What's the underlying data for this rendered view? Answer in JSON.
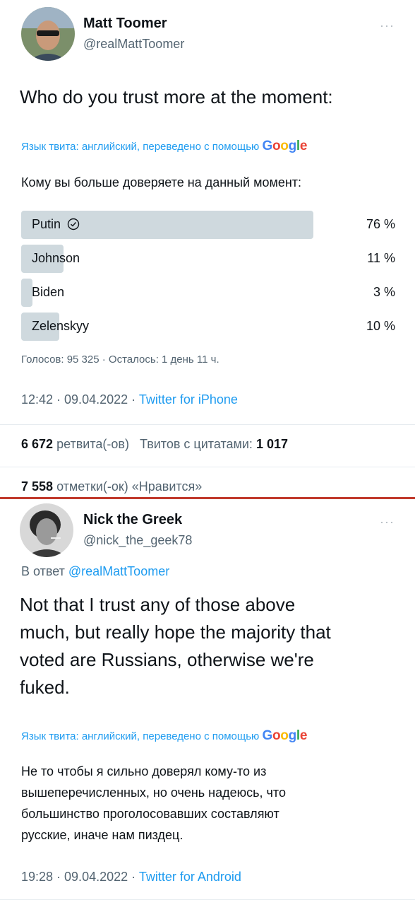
{
  "tweet1": {
    "name": "Matt Toomer",
    "handle": "@realMattToomer",
    "text": "Who do you trust more at the moment:",
    "translate_note": "Язык твита: английский, переведено с помощью",
    "translated": "Кому вы больше доверяете на данный момент:",
    "poll": [
      {
        "label": "Putin",
        "pct": "76 %",
        "fraction": 0.76,
        "winner": true
      },
      {
        "label": "Johnson",
        "pct": "11 %",
        "fraction": 0.11,
        "winner": false
      },
      {
        "label": "Biden",
        "pct": "3 %",
        "fraction": 0.03,
        "winner": false
      },
      {
        "label": "Zelenskyy",
        "pct": "10 %",
        "fraction": 0.1,
        "winner": false
      }
    ],
    "votes": "Голосов: 95 325 · Осталось: 1 день 11 ч.",
    "time": "12:42 · 09.04.2022 · ",
    "source": "Twitter for iPhone",
    "retweets_count": "6 672",
    "retweets_label": "ретвита(-ов)",
    "quotes_label": "Твитов с цитатами:",
    "quotes_count": "1 017",
    "likes_count": "7 558",
    "likes_label": "отметки(-ок) «Нравится»"
  },
  "tweet2": {
    "name": "Nick the Greek",
    "handle": "@nick_the_geek78",
    "reply_prefix": "В ответ ",
    "reply_to": "@realMattToomer",
    "text_lines": [
      "Not that I trust any of those above",
      "much, but really hope the majority that",
      "voted are Russians, otherwise we're",
      "fuked."
    ],
    "translate_note": "Язык твита: английский, переведено с помощью",
    "translated_lines": [
      "Не то чтобы я сильно доверял кому-то из",
      "вышеперечисленных, но очень надеюсь, что",
      "большинство проголосовавших составляют",
      "русские, иначе нам пиздец."
    ],
    "time": "19:28 · 09.04.2022 · ",
    "source": "Twitter for Android"
  },
  "google_letters": [
    "G",
    "o",
    "o",
    "g",
    "l",
    "e"
  ],
  "colors": {
    "link": "#1d9bf0",
    "poll_bar": "#cfd9de",
    "divider_red": "#c0392b"
  },
  "icons": {
    "more": "more-dots-icon",
    "winner": "check-circle-icon"
  }
}
